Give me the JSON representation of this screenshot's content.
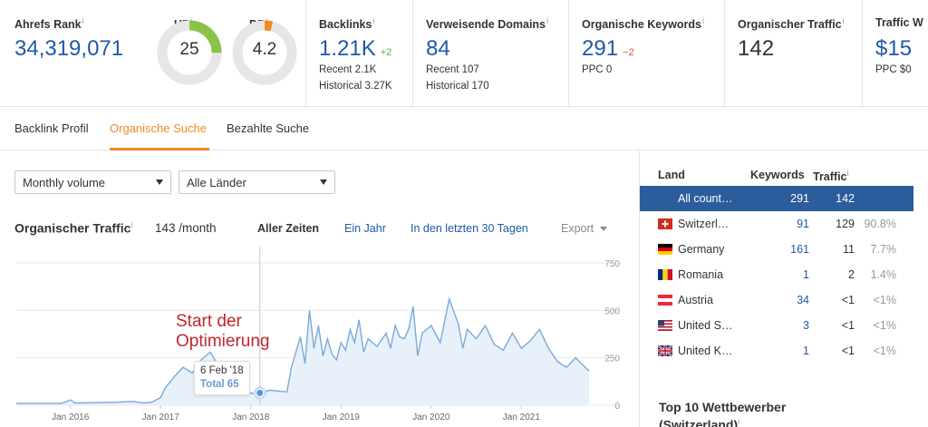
{
  "metrics": {
    "ahrefs_rank": {
      "label": "Ahrefs Rank",
      "value": "34,319,071"
    },
    "ur": {
      "label": "UR",
      "value": "25",
      "level": 0.25,
      "color": "#8bc34a"
    },
    "dr": {
      "label": "DR",
      "value": "4.2",
      "level": 0.042,
      "color": "#f08a24"
    },
    "backlinks": {
      "label": "Backlinks",
      "value": "1.21K",
      "delta": "+2",
      "recent": "Recent 2.1K",
      "historical": "Historical 3.27K"
    },
    "ref_domains": {
      "label": "Verweisende Domains",
      "value": "84",
      "recent": "Recent 107",
      "historical": "Historical 170"
    },
    "org_keywords": {
      "label": "Organische Keywords",
      "value": "291",
      "delta": "−2",
      "ppc": "PPC 0"
    },
    "org_traffic": {
      "label": "Organischer Traffic",
      "value": "142"
    },
    "traffic_value": {
      "label": "Traffic W",
      "value": "$15",
      "ppc": "PPC $0"
    },
    "info": "i"
  },
  "tabs": [
    "Backlink Profil",
    "Organische Suche",
    "Bezahlte Suche"
  ],
  "controls": {
    "volume_select": "Monthly volume",
    "country_select": "Alle Länder"
  },
  "chart_header": {
    "title": "Organischer Traffic",
    "value_text": "143 /month",
    "ranges": [
      "Aller Zeiten",
      "Ein Jahr",
      "In den letzten 30 Tagen"
    ],
    "export": "Export"
  },
  "annotation": {
    "line1": "Start der",
    "line2": "Optimierung"
  },
  "tooltip": {
    "date": "6 Feb '18",
    "total": "Total 65"
  },
  "chart_data": {
    "type": "area",
    "ylim": [
      0,
      750
    ],
    "y_ticks": [
      0,
      250,
      500,
      750
    ],
    "x_tick_labels": [
      "Jan 2016",
      "Jan 2017",
      "Jan 2018",
      "Jan 2019",
      "Jan 2020",
      "Jan 2021"
    ],
    "x_tick_years": [
      2016,
      2017,
      2018,
      2019,
      2020,
      2021
    ],
    "x_range": [
      2015.4,
      2021.75
    ],
    "series": [
      {
        "x": [
          2015.4,
          2015.6,
          2015.9,
          2016.0,
          2016.05,
          2016.3,
          2016.5,
          2016.7,
          2016.8,
          2016.9,
          2017.0,
          2017.05,
          2017.15,
          2017.25,
          2017.35,
          2017.45,
          2017.55,
          2017.65,
          2017.7,
          2017.75,
          2017.85,
          2017.95,
          2018.0,
          2018.08,
          2018.1,
          2018.15,
          2018.2,
          2018.3,
          2018.4,
          2018.45,
          2018.5,
          2018.55,
          2018.6,
          2018.65,
          2018.7,
          2018.75,
          2018.8,
          2018.85,
          2018.9,
          2018.95,
          2019.0,
          2019.05,
          2019.1,
          2019.15,
          2019.2,
          2019.25,
          2019.3,
          2019.4,
          2019.5,
          2019.55,
          2019.6,
          2019.65,
          2019.7,
          2019.75,
          2019.8,
          2019.85,
          2019.9,
          2020.0,
          2020.1,
          2020.2,
          2020.3,
          2020.35,
          2020.4,
          2020.5,
          2020.6,
          2020.7,
          2020.8,
          2020.9,
          2021.0,
          2021.1,
          2021.2,
          2021.3,
          2021.4,
          2021.5,
          2021.6,
          2021.75
        ],
        "y": [
          10,
          10,
          10,
          28,
          12,
          14,
          16,
          20,
          12,
          16,
          40,
          90,
          150,
          200,
          170,
          240,
          280,
          200,
          150,
          120,
          90,
          60,
          65,
          55,
          100,
          65,
          80,
          75,
          70,
          200,
          280,
          360,
          220,
          500,
          300,
          420,
          260,
          350,
          270,
          240,
          330,
          290,
          400,
          330,
          450,
          280,
          350,
          310,
          380,
          300,
          420,
          360,
          350,
          400,
          520,
          260,
          380,
          420,
          330,
          560,
          430,
          300,
          400,
          350,
          420,
          320,
          290,
          380,
          300,
          340,
          400,
          300,
          230,
          200,
          250,
          180
        ]
      }
    ]
  },
  "country_panel": {
    "headers": {
      "land": "Land",
      "keywords": "Keywords",
      "traffic": "Traffic"
    },
    "rows": [
      {
        "flag": "all",
        "name": "All count…",
        "keywords": "291",
        "traffic": "142",
        "pct": ""
      },
      {
        "flag": "ch",
        "name": "Switzerl…",
        "keywords": "91",
        "traffic": "129",
        "pct": "90.8%"
      },
      {
        "flag": "de",
        "name": "Germany",
        "keywords": "161",
        "traffic": "11",
        "pct": "7.7%"
      },
      {
        "flag": "ro",
        "name": "Romania",
        "keywords": "1",
        "traffic": "2",
        "pct": "1.4%"
      },
      {
        "flag": "at",
        "name": "Austria",
        "keywords": "34",
        "traffic": "<1",
        "pct": "<1%"
      },
      {
        "flag": "us",
        "name": "United S…",
        "keywords": "3",
        "traffic": "<1",
        "pct": "<1%"
      },
      {
        "flag": "uk",
        "name": "United K…",
        "keywords": "1",
        "traffic": "<1",
        "pct": "<1%"
      }
    ],
    "competitors_line1": "Top 10 Wettbewerber",
    "competitors_line2": "(Switzerland)"
  }
}
